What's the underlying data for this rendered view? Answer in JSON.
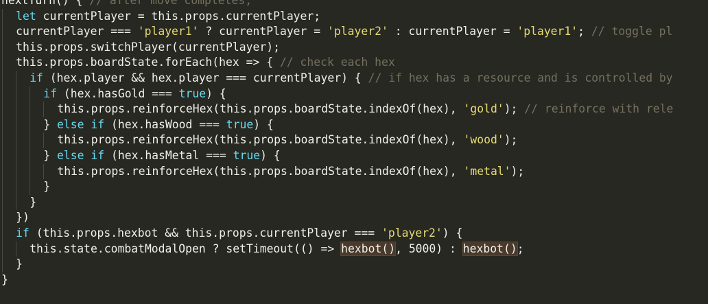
{
  "editor": {
    "lines": [
      {
        "indent": 0,
        "tokens": [
          {
            "type": "plain",
            "text": "nextTurn() { "
          },
          {
            "type": "comment",
            "text": "// after move completes,"
          }
        ]
      },
      {
        "indent": 1,
        "tokens": [
          {
            "type": "keyword",
            "text": "let"
          },
          {
            "type": "plain",
            "text": " currentPlayer = this.props.currentPlayer;"
          }
        ]
      },
      {
        "indent": 1,
        "tokens": [
          {
            "type": "plain",
            "text": "currentPlayer === "
          },
          {
            "type": "string",
            "text": "'player1'"
          },
          {
            "type": "plain",
            "text": " ? currentPlayer = "
          },
          {
            "type": "string",
            "text": "'player2'"
          },
          {
            "type": "plain",
            "text": " : currentPlayer = "
          },
          {
            "type": "string",
            "text": "'player1'"
          },
          {
            "type": "plain",
            "text": "; "
          },
          {
            "type": "comment",
            "text": "// toggle pl"
          }
        ]
      },
      {
        "indent": 1,
        "tokens": [
          {
            "type": "plain",
            "text": "this.props.switchPlayer(currentPlayer);"
          }
        ]
      },
      {
        "indent": 1,
        "tokens": [
          {
            "type": "plain",
            "text": "this.props.boardState.forEach(hex => { "
          },
          {
            "type": "comment",
            "text": "// check each hex"
          }
        ]
      },
      {
        "indent": 2,
        "tokens": [
          {
            "type": "keyword",
            "text": "if"
          },
          {
            "type": "plain",
            "text": " (hex.player && hex.player === currentPlayer) { "
          },
          {
            "type": "comment",
            "text": "// if hex has a resource and is controlled by"
          }
        ]
      },
      {
        "indent": 3,
        "tokens": [
          {
            "type": "keyword",
            "text": "if"
          },
          {
            "type": "plain",
            "text": " (hex.hasGold === "
          },
          {
            "type": "keyword",
            "text": "true"
          },
          {
            "type": "plain",
            "text": ") {"
          }
        ]
      },
      {
        "indent": 4,
        "tokens": [
          {
            "type": "plain",
            "text": "this.props.reinforceHex(this.props.boardState.indexOf(hex), "
          },
          {
            "type": "string",
            "text": "'gold'"
          },
          {
            "type": "plain",
            "text": "); "
          },
          {
            "type": "comment",
            "text": "// reinforce with rele"
          }
        ]
      },
      {
        "indent": 3,
        "tokens": [
          {
            "type": "plain",
            "text": "} "
          },
          {
            "type": "keyword",
            "text": "else if"
          },
          {
            "type": "plain",
            "text": " (hex.hasWood === "
          },
          {
            "type": "keyword",
            "text": "true"
          },
          {
            "type": "plain",
            "text": ") {"
          }
        ]
      },
      {
        "indent": 4,
        "tokens": [
          {
            "type": "plain",
            "text": "this.props.reinforceHex(this.props.boardState.indexOf(hex), "
          },
          {
            "type": "string",
            "text": "'wood'"
          },
          {
            "type": "plain",
            "text": ");"
          }
        ]
      },
      {
        "indent": 3,
        "tokens": [
          {
            "type": "plain",
            "text": "} "
          },
          {
            "type": "keyword",
            "text": "else if"
          },
          {
            "type": "plain",
            "text": " (hex.hasMetal === "
          },
          {
            "type": "keyword",
            "text": "true"
          },
          {
            "type": "plain",
            "text": ") {"
          }
        ]
      },
      {
        "indent": 4,
        "tokens": [
          {
            "type": "plain",
            "text": "this.props.reinforceHex(this.props.boardState.indexOf(hex), "
          },
          {
            "type": "string",
            "text": "'metal'"
          },
          {
            "type": "plain",
            "text": ");"
          }
        ]
      },
      {
        "indent": 3,
        "tokens": [
          {
            "type": "plain",
            "text": "}"
          }
        ]
      },
      {
        "indent": 2,
        "tokens": [
          {
            "type": "plain",
            "text": "}"
          }
        ]
      },
      {
        "indent": 1,
        "tokens": [
          {
            "type": "plain",
            "text": "})"
          }
        ]
      },
      {
        "indent": 1,
        "tokens": [
          {
            "type": "keyword",
            "text": "if"
          },
          {
            "type": "plain",
            "text": " (this.props.hexbot && this.props.currentPlayer === "
          },
          {
            "type": "string",
            "text": "'player2'"
          },
          {
            "type": "plain",
            "text": ") {"
          }
        ]
      },
      {
        "indent": 2,
        "tokens": [
          {
            "type": "plain",
            "text": "this.state.combatModalOpen ? setTimeout(() => "
          },
          {
            "type": "hl",
            "text": "hexbot()"
          },
          {
            "type": "plain",
            "text": ", 5000) : "
          },
          {
            "type": "hl",
            "text": "hexbot()"
          },
          {
            "type": "plain",
            "text": ";"
          }
        ]
      },
      {
        "indent": 1,
        "tokens": [
          {
            "type": "plain",
            "text": "}"
          }
        ]
      },
      {
        "indent": 0,
        "tokens": [
          {
            "type": "plain",
            "text": "}"
          }
        ]
      }
    ]
  },
  "colors": {
    "background": "#272822",
    "plain": "#f0f0ea",
    "keyword": "#66d9ef",
    "string": "#e6db74",
    "comment": "#75715e",
    "highlight_bg": "#4a3a2c",
    "indent_guide": "#4a4a44"
  }
}
